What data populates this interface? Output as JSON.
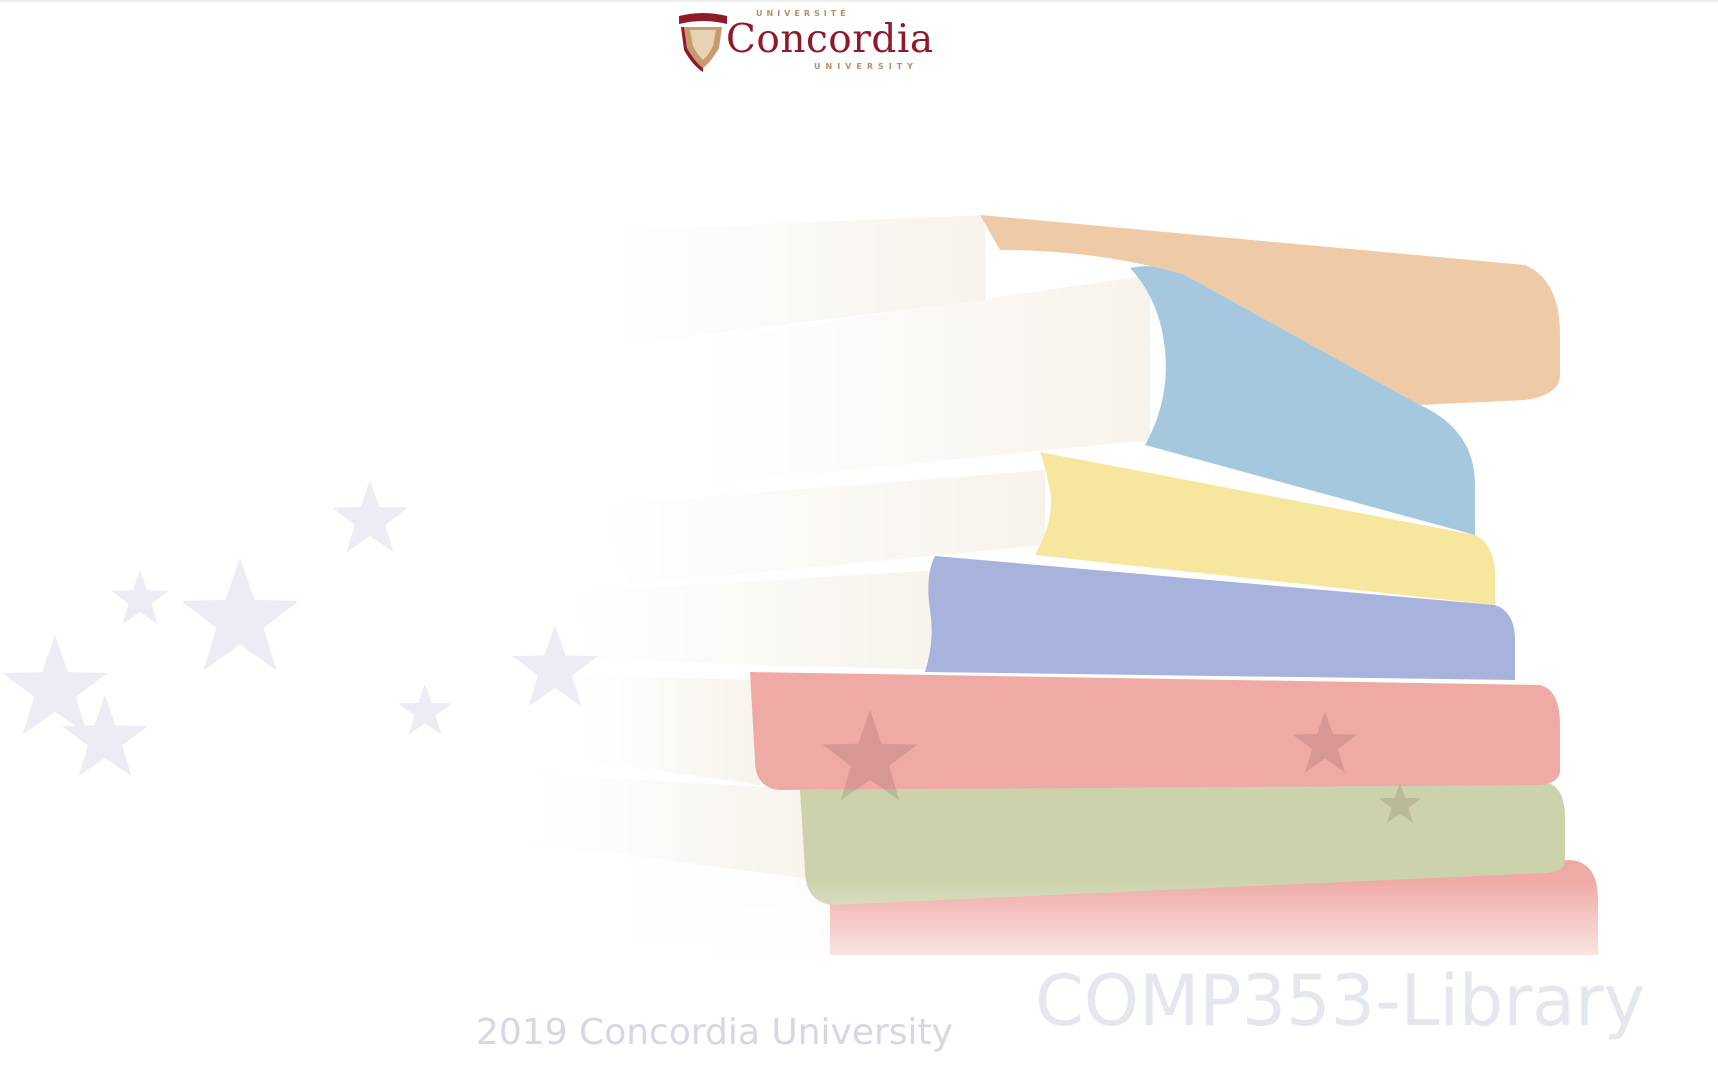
{
  "logo": {
    "university_fr": "UNIVERSITÉ",
    "name": "Concordia",
    "university_en": "UNIVERSITY"
  },
  "footer": {
    "copyright": "2019 Concordia University"
  },
  "course": {
    "title": "COMP353-Library"
  },
  "colors": {
    "brand": "#8f1a2a",
    "gold": "#b5916a",
    "book_orange": "#eecaa6",
    "book_light_blue": "#a6c8de",
    "book_yellow": "#f7e79e",
    "book_navy": "#a7b3dc",
    "book_red": "#efaaa5",
    "book_olive": "#ccd2ab",
    "star": "#ecedf4"
  },
  "icons": {
    "shield": "concordia-shield-icon",
    "stars": "star-icon",
    "books": "book-stack-illustration"
  }
}
